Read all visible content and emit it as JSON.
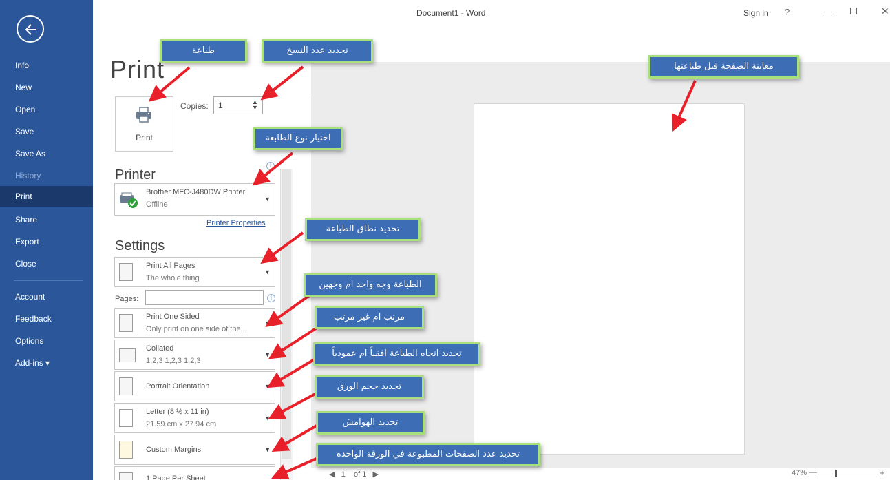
{
  "titlebar": {
    "doc_title": "Document1  -  Word",
    "signin": "Sign in",
    "help": "?",
    "minimize": "—",
    "close": "✕"
  },
  "sidebar": {
    "items": [
      {
        "label": "Info"
      },
      {
        "label": "New"
      },
      {
        "label": "Open"
      },
      {
        "label": "Save"
      },
      {
        "label": "Save As"
      },
      {
        "label": "History"
      },
      {
        "label": "Print"
      },
      {
        "label": "Share"
      },
      {
        "label": "Export"
      },
      {
        "label": "Close"
      },
      {
        "label": "Account"
      },
      {
        "label": "Feedback"
      },
      {
        "label": "Options"
      },
      {
        "label": "Add-ins ▾"
      }
    ]
  },
  "print": {
    "heading": "Print",
    "button_label": "Print",
    "copies_label": "Copies:",
    "copies_value": "1",
    "printer_heading": "Printer",
    "printer_name": "Brother MFC-J480DW Printer",
    "printer_status": "Offline",
    "printer_properties": "Printer Properties",
    "settings_heading": "Settings",
    "print_all_title": "Print All Pages",
    "print_all_sub": "The whole thing",
    "pages_label": "Pages:",
    "sided_title": "Print One Sided",
    "sided_sub": "Only print on one side of the...",
    "collated_title": "Collated",
    "collated_sub": "1,2,3    1,2,3    1,2,3",
    "orientation": "Portrait Orientation",
    "paper_title": "Letter (8 ½ x 11 in)",
    "paper_sub": "21.59 cm x 27.94 cm",
    "margins": "Custom Margins",
    "per_sheet": "1 Page Per Sheet"
  },
  "preview": {
    "page_prev": "◀",
    "current_page": "1",
    "of_pages": "of 1",
    "page_next": "▶",
    "zoom": "47%",
    "zoom_minus": "—",
    "zoom_plus": "+"
  },
  "callouts": {
    "print": "طباعة",
    "copies": "تحديد عدد النسخ",
    "preview": "معاينة الصفحة قبل طباعتها",
    "printer_type": "اختيار نوع الطابعة",
    "range": "تحديد نطاق الطباعة",
    "sides": "الطباعة وجه واحد ام وجهين",
    "collation": "مرتب ام غير مرتب",
    "orientation": "تحديد اتجاه الطباعة افقياً ام عمودياً",
    "paper_size": "تحديد حجم الورق",
    "margins": "تحديد الهوامش",
    "pages_per_sheet": "تحديد عدد الصفحات المطبوعة في الورقة الواحدة"
  },
  "colors": {
    "sidebar": "#2b579a",
    "callout_fill": "#3d6db5",
    "callout_border": "#a7e07c",
    "arrow": "#e8202a"
  }
}
